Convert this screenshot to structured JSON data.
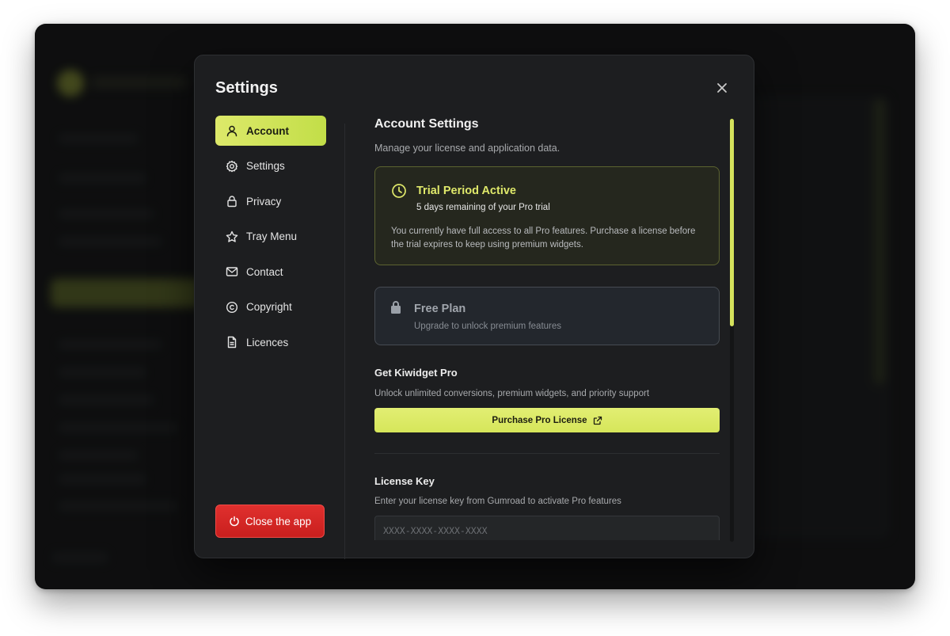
{
  "modal": {
    "title": "Settings"
  },
  "nav": {
    "items": [
      {
        "label": "Account",
        "icon": "user-icon",
        "active": true
      },
      {
        "label": "Settings",
        "icon": "gear-icon",
        "active": false
      },
      {
        "label": "Privacy",
        "icon": "lock-icon",
        "active": false
      },
      {
        "label": "Tray Menu",
        "icon": "star-icon",
        "active": false
      },
      {
        "label": "Contact",
        "icon": "mail-icon",
        "active": false
      },
      {
        "label": "Copyright",
        "icon": "copyright-icon",
        "active": false
      },
      {
        "label": "Licences",
        "icon": "document-icon",
        "active": false
      }
    ],
    "close_app_label": "Close the app"
  },
  "account": {
    "title": "Account Settings",
    "subtitle": "Manage your license and application data.",
    "trial": {
      "title": "Trial Period Active",
      "subtitle": "5 days remaining of your Pro trial",
      "body": "You currently have full access to all Pro features. Purchase a license before the trial expires to keep using premium widgets."
    },
    "free_plan": {
      "title": "Free Plan",
      "subtitle": "Upgrade to unlock premium features"
    },
    "pro": {
      "title": "Get Kiwidget Pro",
      "subtitle": "Unlock unlimited conversions, premium widgets, and priority support",
      "button_label": "Purchase Pro License"
    },
    "license": {
      "title": "License Key",
      "subtitle": "Enter your license key from Gumroad to activate Pro features",
      "placeholder": "XXXX-XXXX-XXXX-XXXX",
      "value": ""
    }
  },
  "colors": {
    "accent": "#d6e65a",
    "danger": "#d42826",
    "background": "#1d1e20"
  }
}
